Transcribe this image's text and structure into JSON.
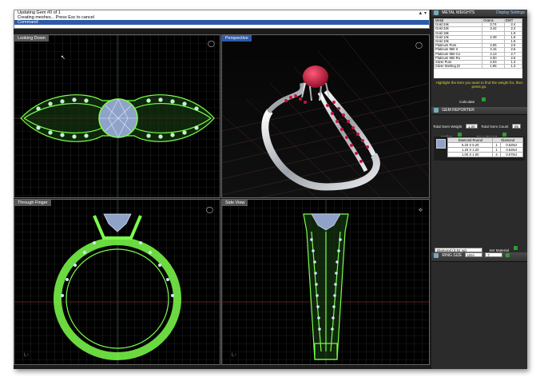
{
  "command": {
    "lines": [
      "Updating Gem #0 of 1",
      "Creating meshes... Press Esc to cancel",
      "Command:"
    ]
  },
  "viewports": [
    {
      "title": "Looking Down",
      "view": "top"
    },
    {
      "title": "Perspective",
      "view": "perspective"
    },
    {
      "title": "Through Finger",
      "view": "front"
    },
    {
      "title": "Side View",
      "view": "side"
    }
  ],
  "metal_weights": {
    "title": "METAL WEIGHTS",
    "header_right": "Display Settings",
    "columns": [
      "Metal",
      "Grams",
      "DWT"
    ],
    "rows": [
      [
        "Gold 24k",
        "3.74",
        "2.4"
      ],
      [
        "Gold 22k",
        "3.42",
        "2.2"
      ],
      [
        "Gold 18k",
        "",
        "1.9"
      ],
      [
        "Gold 14k",
        "2.49",
        "1.6"
      ],
      [
        "Gold 10k",
        "",
        "1.5"
      ],
      [
        "Platinum Pure",
        "4.05",
        "2.6"
      ],
      [
        "Platinum 950 Ir",
        "4.15",
        "2.6"
      ],
      [
        "Platinum 950 Co",
        "4.13",
        "2.7"
      ],
      [
        "Platinum 950 Ru",
        "4.00",
        "2.6"
      ],
      [
        "Silver Pure",
        "2.03",
        "1.3"
      ],
      [
        "Silver Sterling (9",
        "1.95",
        "1.3"
      ]
    ],
    "hint": "Highlight the item you want to find the weight for, then press go.",
    "calculate_label": "Calculate"
  },
  "gem_reporter": {
    "title": "GEM REPORTER",
    "total_weight_label": "Total Gem Weight",
    "total_weight_value": "1.00",
    "total_count_label": "Total Gem Count",
    "total_count_value": "85",
    "update_label": "Update",
    "save_report_label": "Save Report",
    "columns": [
      "Diamond Round",
      "Diamond"
    ],
    "rows": [
      {
        "size": "5.20 X 5.20",
        "count": "1",
        "weight": "0.525ct"
      },
      {
        "size": "1.20 X 1.20",
        "count": "1",
        "weight": "0.526ct"
      },
      {
        "size": "1.00 X 1.00",
        "count": "4",
        "weight": "0.076ct"
      }
    ],
    "material_value": "Diamond (3.52 sg)",
    "set_material_label": "Set Material"
  },
  "ring_size": {
    "title": "RING SIZE",
    "standard_value": "USA",
    "size_value": "7"
  },
  "colors": {
    "active_title": "#2c5aa8",
    "wire_green": "#7cff4a",
    "gem_blue": "#9fb8e8",
    "ruby": "#c4143c",
    "metal": "#d9dde2"
  }
}
